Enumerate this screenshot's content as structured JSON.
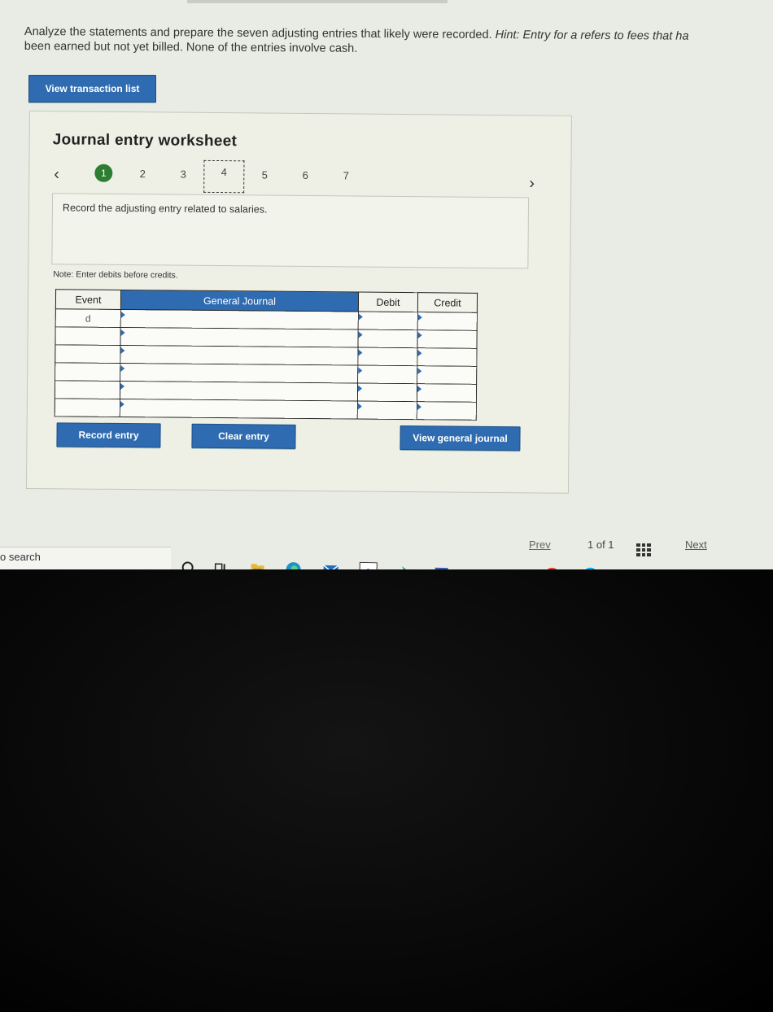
{
  "instructions": {
    "line1": "Analyze the statements and prepare the seven adjusting entries that likely were recorded.",
    "hint_label": "Hint:",
    "hint_text": "Entry for a refers to fees that ha",
    "line2": "been earned but not yet billed. None of the entries involve cash."
  },
  "buttons": {
    "view_transaction_list": "View transaction list",
    "record_entry": "Record entry",
    "clear_entry": "Clear entry",
    "view_general_journal": "View general journal"
  },
  "worksheet": {
    "title": "Journal entry worksheet",
    "steps": [
      "1",
      "2",
      "3",
      "4",
      "5",
      "6",
      "7"
    ],
    "current_step": "4",
    "prompt": "Record the adjusting entry related to salaries.",
    "note": "Note: Enter debits before credits."
  },
  "journal": {
    "headers": {
      "event": "Event",
      "general_journal": "General Journal",
      "debit": "Debit",
      "credit": "Credit"
    },
    "rows": [
      {
        "event": "d",
        "account": "",
        "debit": "",
        "credit": ""
      },
      {
        "event": "",
        "account": "",
        "debit": "",
        "credit": ""
      },
      {
        "event": "",
        "account": "",
        "debit": "",
        "credit": ""
      },
      {
        "event": "",
        "account": "",
        "debit": "",
        "credit": ""
      },
      {
        "event": "",
        "account": "",
        "debit": "",
        "credit": ""
      },
      {
        "event": "",
        "account": "",
        "debit": "",
        "credit": ""
      }
    ]
  },
  "pager": {
    "prev": "Prev",
    "count": "1 of 1",
    "next": "Next"
  },
  "taskbar": {
    "search_text": "o search",
    "icons": [
      "cortana-icon",
      "task-view-icon",
      "file-explorer-icon",
      "edge-icon",
      "mail-icon",
      "amazon-icon",
      "app-icon",
      "network-icon",
      "camera-icon",
      "store-icon",
      "chrome-icon",
      "skype-icon"
    ],
    "amazon_glyph": "a"
  }
}
